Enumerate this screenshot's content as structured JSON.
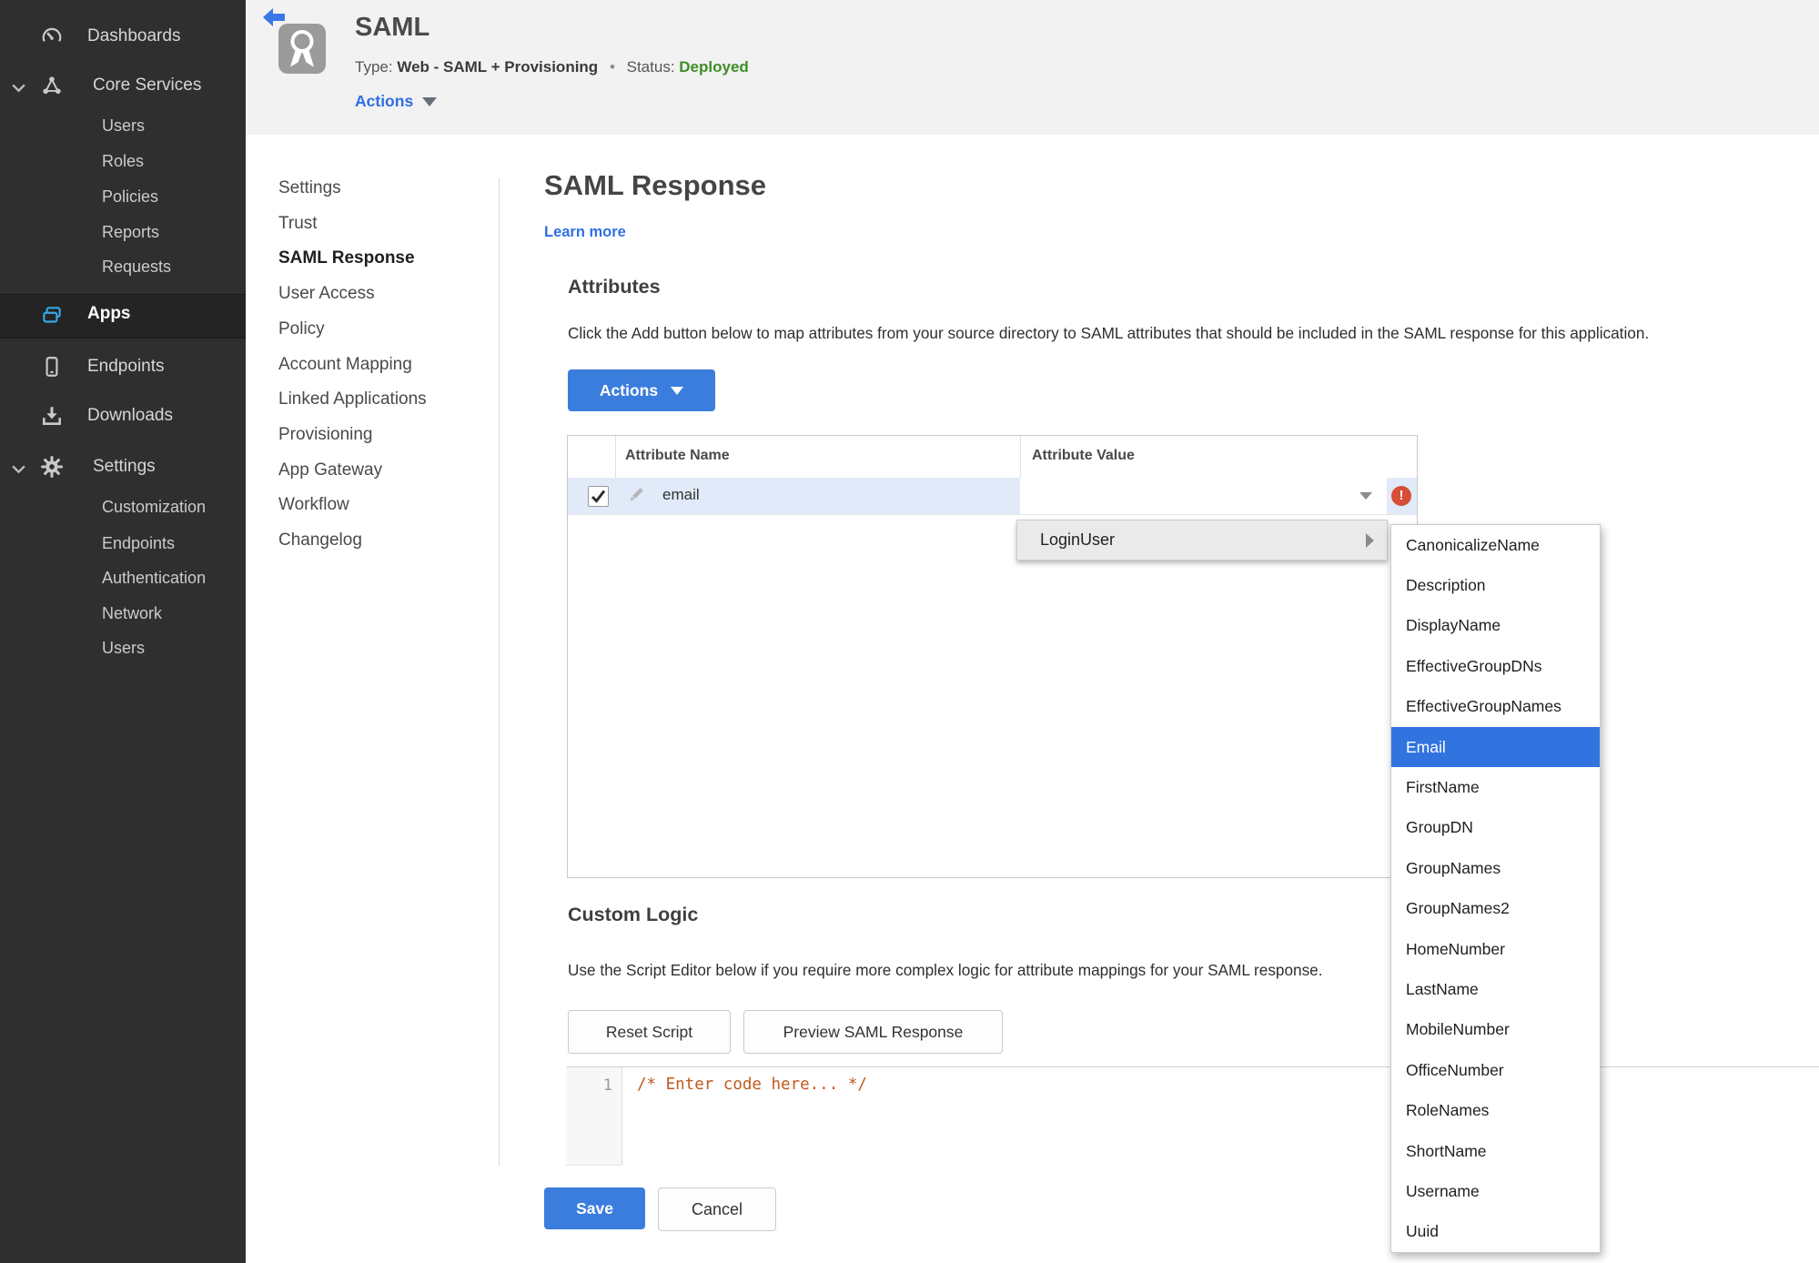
{
  "colors": {
    "accent_blue": "#3b7ddd",
    "link_blue": "#2f6fe4",
    "status_green": "#3e8e28",
    "error_red": "#d54e35",
    "row_highlight": "#e1eaf8",
    "menu_selected": "#3174e0",
    "sidebar_bg": "#2f2f2f",
    "header_bg": "#f2f2f2",
    "code_comment": "#c05a1e"
  },
  "sidebar": {
    "dashboards": "Dashboards",
    "core_services": "Core Services",
    "core_children": {
      "users": "Users",
      "roles": "Roles",
      "policies": "Policies",
      "reports": "Reports",
      "requests": "Requests"
    },
    "apps": "Apps",
    "endpoints": "Endpoints",
    "downloads": "Downloads",
    "settings": "Settings",
    "settings_children": {
      "customization": "Customization",
      "endpoints": "Endpoints",
      "authentication": "Authentication",
      "network": "Network",
      "users": "Users"
    }
  },
  "header": {
    "title": "SAML",
    "type_label": "Type:",
    "type_value": "Web - SAML + Provisioning",
    "separator": "•",
    "status_label": "Status:",
    "status_value": "Deployed",
    "actions_label": "Actions"
  },
  "subnav": {
    "items": [
      "Settings",
      "Trust",
      "SAML Response",
      "User Access",
      "Policy",
      "Account Mapping",
      "Linked Applications",
      "Provisioning",
      "App Gateway",
      "Workflow",
      "Changelog"
    ],
    "active": "SAML Response"
  },
  "main": {
    "title": "SAML Response",
    "learn_more": "Learn more",
    "attributes": {
      "heading": "Attributes",
      "description": "Click the Add button below to map attributes from your source directory to SAML attributes that should be included in the SAML response for this application.",
      "actions_button": "Actions"
    },
    "table": {
      "columns": {
        "name": "Attribute Name",
        "value": "Attribute Value"
      },
      "rows": [
        {
          "name": "email",
          "value": "",
          "checked": true,
          "error": true
        }
      ],
      "error_icon_glyph": "!"
    },
    "value_menu": {
      "parent": "LoginUser",
      "selected": "Email",
      "items": [
        "CanonicalizeName",
        "Description",
        "DisplayName",
        "EffectiveGroupDNs",
        "EffectiveGroupNames",
        "Email",
        "FirstName",
        "GroupDN",
        "GroupNames",
        "GroupNames2",
        "HomeNumber",
        "LastName",
        "MobileNumber",
        "OfficeNumber",
        "RoleNames",
        "ShortName",
        "Username",
        "Uuid"
      ]
    },
    "custom_logic": {
      "heading": "Custom Logic",
      "description": "Use the Script Editor below if you require more complex logic for attribute mappings for your SAML response.",
      "reset_button": "Reset Script",
      "preview_button": "Preview SAML Response",
      "editor": {
        "line_number": "1",
        "code": "/* Enter code here... */"
      }
    },
    "save_button": "Save",
    "cancel_button": "Cancel"
  }
}
